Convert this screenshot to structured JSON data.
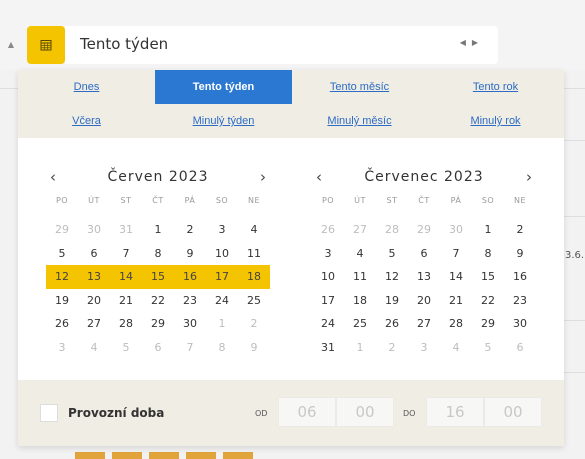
{
  "date_field": {
    "value": "Tento týden",
    "icon": "calendar-icon",
    "nav_icons": [
      "chevron-left-icon",
      "chevron-right-icon"
    ]
  },
  "quick_ranges": [
    {
      "label": "Dnes",
      "active": false
    },
    {
      "label": "Tento týden",
      "active": true
    },
    {
      "label": "Tento měsíc",
      "active": false
    },
    {
      "label": "Tento rok",
      "active": false
    },
    {
      "label": "Včera",
      "active": false
    },
    {
      "label": "Minulý týden",
      "active": false
    },
    {
      "label": "Minulý měsíc",
      "active": false
    },
    {
      "label": "Minulý rok",
      "active": false
    }
  ],
  "weekdays": [
    "PO",
    "ÚT",
    "ST",
    "ČT",
    "PÁ",
    "SO",
    "NE"
  ],
  "months": [
    {
      "title": "Červen 2023",
      "weeks": [
        [
          {
            "d": "29",
            "m": true
          },
          {
            "d": "30",
            "m": true
          },
          {
            "d": "31",
            "m": true
          },
          {
            "d": "1"
          },
          {
            "d": "2"
          },
          {
            "d": "3"
          },
          {
            "d": "4"
          }
        ],
        [
          {
            "d": "5"
          },
          {
            "d": "6"
          },
          {
            "d": "7"
          },
          {
            "d": "8"
          },
          {
            "d": "9"
          },
          {
            "d": "10"
          },
          {
            "d": "11"
          }
        ],
        [
          {
            "d": "12",
            "s": true
          },
          {
            "d": "13",
            "s": true
          },
          {
            "d": "14",
            "s": true
          },
          {
            "d": "15",
            "s": true
          },
          {
            "d": "16",
            "s": true
          },
          {
            "d": "17",
            "s": true
          },
          {
            "d": "18",
            "s": true
          }
        ],
        [
          {
            "d": "19"
          },
          {
            "d": "20"
          },
          {
            "d": "21"
          },
          {
            "d": "22"
          },
          {
            "d": "23"
          },
          {
            "d": "24"
          },
          {
            "d": "25"
          }
        ],
        [
          {
            "d": "26"
          },
          {
            "d": "27"
          },
          {
            "d": "28"
          },
          {
            "d": "29"
          },
          {
            "d": "30"
          },
          {
            "d": "1",
            "m": true
          },
          {
            "d": "2",
            "m": true
          }
        ],
        [
          {
            "d": "3",
            "m": true
          },
          {
            "d": "4",
            "m": true
          },
          {
            "d": "5",
            "m": true
          },
          {
            "d": "6",
            "m": true
          },
          {
            "d": "7",
            "m": true
          },
          {
            "d": "8",
            "m": true
          },
          {
            "d": "9",
            "m": true
          }
        ]
      ]
    },
    {
      "title": "Červenec 2023",
      "weeks": [
        [
          {
            "d": "26",
            "m": true
          },
          {
            "d": "27",
            "m": true
          },
          {
            "d": "28",
            "m": true
          },
          {
            "d": "29",
            "m": true
          },
          {
            "d": "30",
            "m": true
          },
          {
            "d": "1"
          },
          {
            "d": "2"
          }
        ],
        [
          {
            "d": "3"
          },
          {
            "d": "4"
          },
          {
            "d": "5"
          },
          {
            "d": "6"
          },
          {
            "d": "7"
          },
          {
            "d": "8"
          },
          {
            "d": "9"
          }
        ],
        [
          {
            "d": "10"
          },
          {
            "d": "11"
          },
          {
            "d": "12"
          },
          {
            "d": "13"
          },
          {
            "d": "14"
          },
          {
            "d": "15"
          },
          {
            "d": "16"
          }
        ],
        [
          {
            "d": "17"
          },
          {
            "d": "18"
          },
          {
            "d": "19"
          },
          {
            "d": "20"
          },
          {
            "d": "21"
          },
          {
            "d": "22"
          },
          {
            "d": "23"
          }
        ],
        [
          {
            "d": "24"
          },
          {
            "d": "25"
          },
          {
            "d": "26"
          },
          {
            "d": "27"
          },
          {
            "d": "28"
          },
          {
            "d": "29"
          },
          {
            "d": "30"
          }
        ],
        [
          {
            "d": "31"
          },
          {
            "d": "1",
            "m": true
          },
          {
            "d": "2",
            "m": true
          },
          {
            "d": "3",
            "m": true
          },
          {
            "d": "4",
            "m": true
          },
          {
            "d": "5",
            "m": true
          },
          {
            "d": "6",
            "m": true
          }
        ]
      ]
    }
  ],
  "nav": {
    "prev": "‹",
    "next": "›"
  },
  "footer": {
    "checkbox_label": "Provozní doba",
    "from_label": "OD",
    "to_label": "DO",
    "from_hour": "06",
    "from_minute": "00",
    "to_hour": "16",
    "to_minute": "00"
  },
  "background": {
    "partial_text": "3.6.,"
  },
  "colors": {
    "accent_yellow": "#f5c400",
    "active_blue": "#2a78d2",
    "link_blue": "#2d6bc4",
    "panel_beige": "#efede4"
  }
}
